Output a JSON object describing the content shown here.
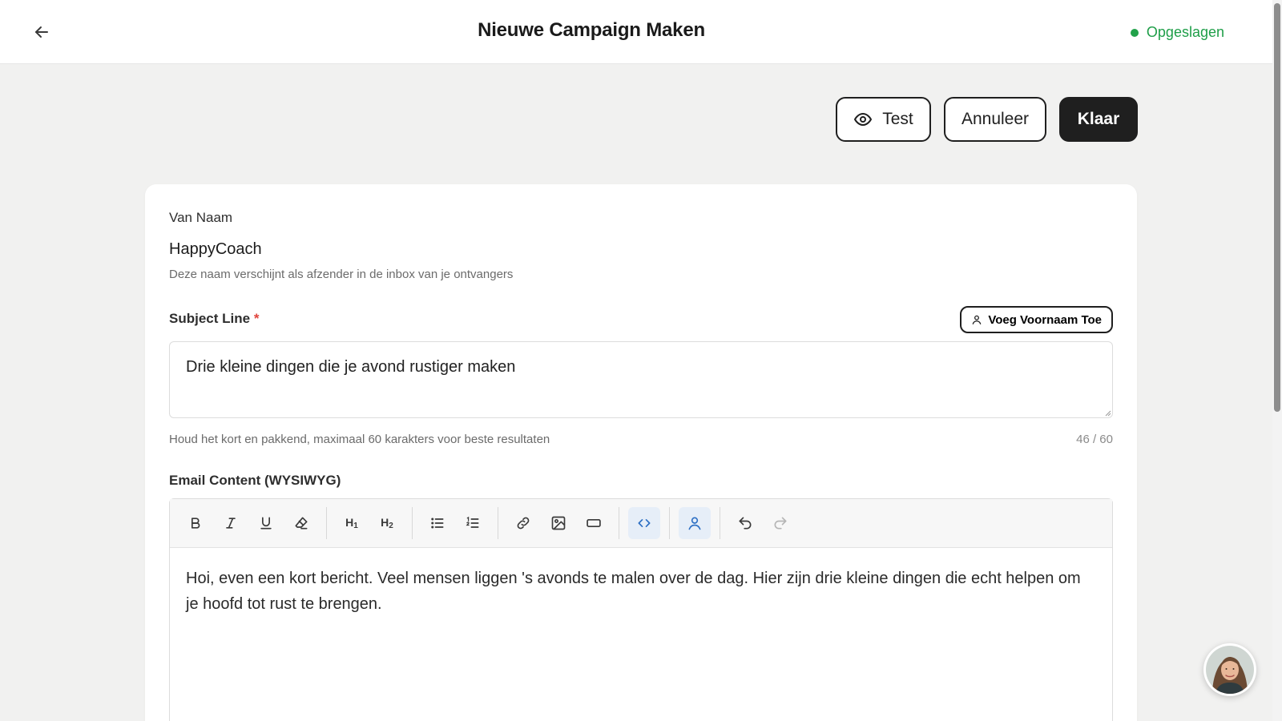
{
  "header": {
    "title": "Nieuwe Campaign Maken",
    "status": "Opgeslagen"
  },
  "actions": {
    "test_label": "Test",
    "cancel_label": "Annuleer",
    "done_label": "Klaar"
  },
  "form": {
    "from_name": {
      "label": "Van Naam",
      "value": "HappyCoach",
      "hint": "Deze naam verschijnt als afzender in de inbox van je ontvangers"
    },
    "subject": {
      "label": "Subject Line",
      "required_mark": "*",
      "add_first_name_label": "Voeg Voornaam Toe",
      "value": "Drie kleine dingen die je avond rustiger maken",
      "hint": "Houd het kort en pakkend, maximaal 60 karakters voor beste resultaten",
      "counter": "46 / 60"
    },
    "content": {
      "label": "Email Content (WYSIWYG)",
      "body": "Hoi, even een kort bericht. Veel mensen liggen 's avonds te malen over de dag. Hier zijn drie kleine dingen die echt helpen om je hoofd tot rust te brengen."
    }
  },
  "toolbar": {
    "h1_label": "H",
    "h1_sub": "1",
    "h2_label": "H",
    "h2_sub": "2",
    "icons": [
      "bold-icon",
      "italic-icon",
      "underline-icon",
      "clear-format-icon",
      "heading-1-icon",
      "heading-2-icon",
      "bullet-list-icon",
      "numbered-list-icon",
      "link-icon",
      "image-icon",
      "button-block-icon",
      "code-icon",
      "personalize-icon",
      "undo-icon",
      "redo-icon"
    ]
  },
  "colors": {
    "accent_green": "#1e9e48",
    "dark": "#1f1f1f",
    "active_blue": "#2d6fc4",
    "required_red": "#e0443c"
  }
}
